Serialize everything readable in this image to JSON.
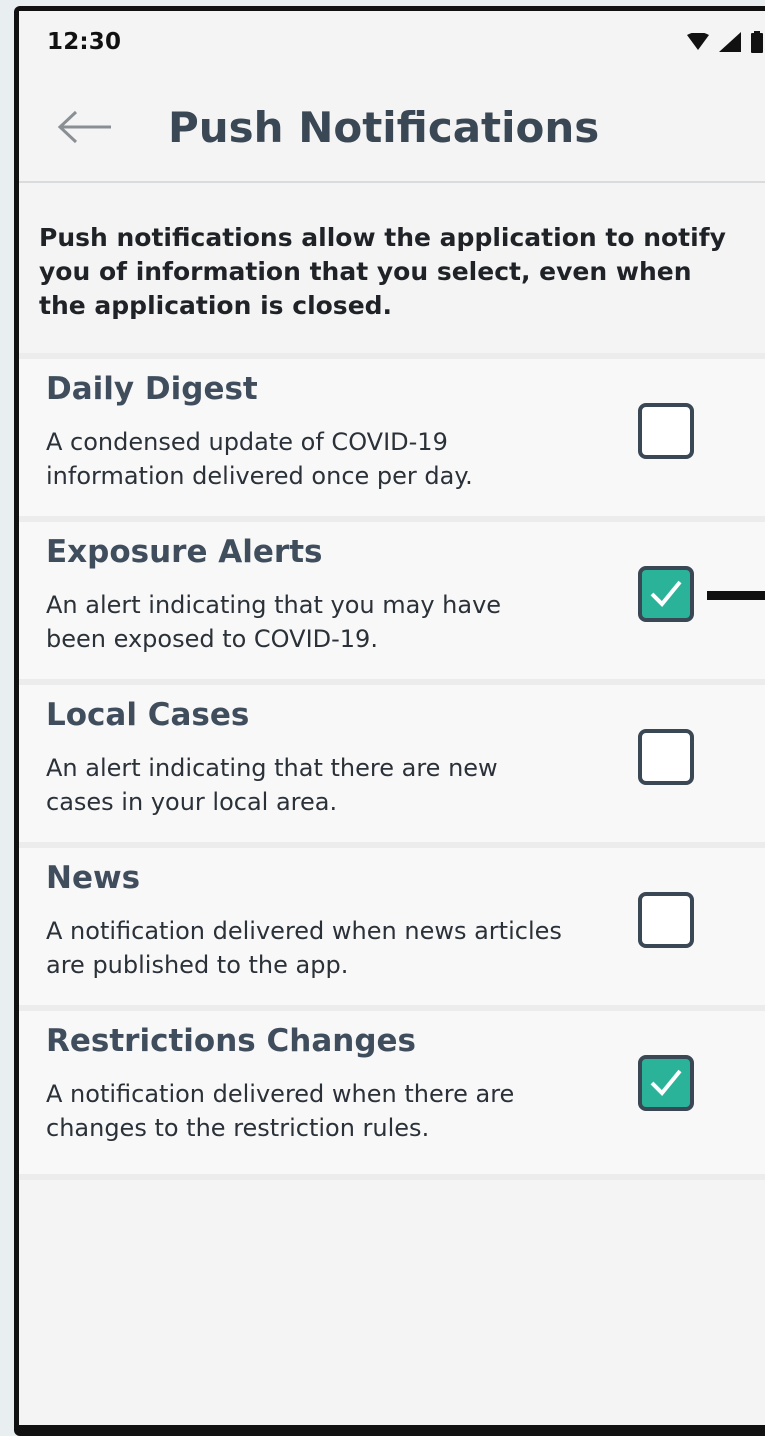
{
  "status": {
    "time": "12:30"
  },
  "header": {
    "title": "Push Notifications"
  },
  "intro": "Push notifications allow the application to notify you of information that you select, even when the application is closed.",
  "items": [
    {
      "name": "Daily Digest",
      "desc": "A condensed update of COVID-19 information delivered once per day.",
      "checked": false
    },
    {
      "name": "Exposure Alerts",
      "desc": "An alert indicating that you may have been exposed to COVID-19.",
      "checked": true
    },
    {
      "name": "Local Cases",
      "desc": "An alert indicating that there are new cases in your local area.",
      "checked": false
    },
    {
      "name": "News",
      "desc": "A notification delivered when news articles are published to the app.",
      "checked": false
    },
    {
      "name": "Restrictions Changes",
      "desc": "A notification delivered when there are changes to the restriction rules.",
      "checked": true
    }
  ],
  "colors": {
    "accent": "#2bb39a",
    "title": "#3a4754"
  },
  "icons": {
    "back": "arrow-left-icon",
    "check": "checkmark-icon"
  }
}
